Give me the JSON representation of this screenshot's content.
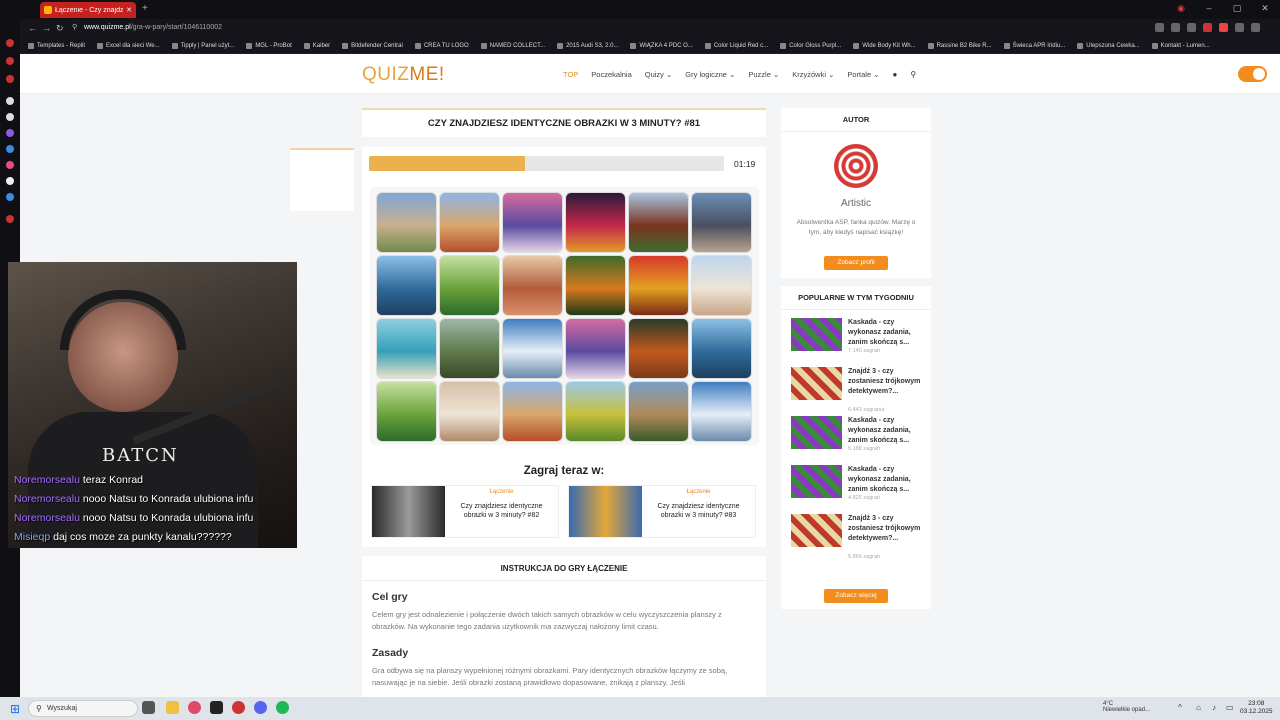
{
  "browser": {
    "tab_title": "Łączenie - Czy znajdziesz",
    "url_host": "www.quizme.pl",
    "url_path": "/gra-w-pary/start/1046110002",
    "bookmarks": [
      "Templates - Replit",
      "Excel dla sieci We...",
      "Tipply | Panel użyt...",
      "MGL - ProBot",
      "Kaiber",
      "Bitdefender Central",
      "CREA TU LOGO",
      "NAMED COLLECT...",
      "2015 Audi S3, 2.0...",
      "WIĄZKA 4 PDC O...",
      "Color Liquid Red c...",
      "Color Gloss Purpl...",
      "Wide Body Kit Wh...",
      "Rassine B2 Bike R...",
      "Świeca APR Iridiu...",
      "Ulepszona Cewka...",
      "Kontakt - Lumen..."
    ]
  },
  "site": {
    "logo_a": "QUIZ",
    "logo_b": "ME!",
    "nav": [
      "TOP",
      "Poczekalnia",
      "Quizy ⌄",
      "Gry logiczne ⌄",
      "Puzzle ⌄",
      "Krzyżówki ⌄",
      "Portale ⌄"
    ]
  },
  "game": {
    "title": "CZY ZNAJDZIESZ IDENTYCZNE OBRAZKI W 3 MINUTY? #81",
    "progress_fraction": 0.44,
    "timer": "01:19",
    "tiles": [
      {
        "name": "osaka-castle",
        "colors": [
          "#7fa6d6",
          "#c9b08e",
          "#6e8a4a"
        ]
      },
      {
        "name": "thai-temple",
        "colors": [
          "#8fb5e8",
          "#d9a76a",
          "#b54d2a"
        ]
      },
      {
        "name": "neon-street",
        "colors": [
          "#d56ba0",
          "#5a4ba0",
          "#e3d4e8"
        ]
      },
      {
        "name": "night-bus",
        "colors": [
          "#2a1c3a",
          "#c2264a",
          "#e59a2a"
        ]
      },
      {
        "name": "pagoda",
        "colors": [
          "#a9c7e3",
          "#7a3420",
          "#3f6a30"
        ]
      },
      {
        "name": "shibuya-street",
        "colors": [
          "#6c8fb8",
          "#4a4f5e",
          "#b6a48e"
        ]
      },
      {
        "name": "torii-sea",
        "colors": [
          "#8cc0e6",
          "#2f6b9c",
          "#1e3f5e"
        ]
      },
      {
        "name": "rice-terraces",
        "colors": [
          "#c5e0a0",
          "#6aa33c",
          "#2d6a2a"
        ]
      },
      {
        "name": "kimono-women",
        "colors": [
          "#e6c9a8",
          "#b35c3a",
          "#d98f6a"
        ]
      },
      {
        "name": "tiger",
        "colors": [
          "#3f6a2a",
          "#d67a1e",
          "#1f3a16"
        ]
      },
      {
        "name": "lanterns",
        "colors": [
          "#d63a2a",
          "#e3a020",
          "#7a2a16"
        ]
      },
      {
        "name": "taj-mahal",
        "colors": [
          "#bfd6ee",
          "#eee4d6",
          "#c9a68a"
        ]
      },
      {
        "name": "beach-boat",
        "colors": [
          "#8dd0e0",
          "#34a0b8",
          "#e8e2c8"
        ]
      },
      {
        "name": "great-wall",
        "colors": [
          "#9cb8a8",
          "#5f7a4a",
          "#3a4a2a"
        ]
      },
      {
        "name": "snow-mountain",
        "colors": [
          "#3f7ec0",
          "#e6eef8",
          "#6a8aa8"
        ]
      },
      {
        "name": "neon-street-2",
        "colors": [
          "#d56ba0",
          "#5a4ba0",
          "#e3d4e8"
        ]
      },
      {
        "name": "orangutan",
        "colors": [
          "#2a3a2a",
          "#c25a1e",
          "#7a3a16"
        ]
      },
      {
        "name": "torii-sea-2",
        "colors": [
          "#8cc0e6",
          "#2f6b9c",
          "#1e3f5e"
        ]
      },
      {
        "name": "rice-terraces-2",
        "colors": [
          "#c5e0a0",
          "#6aa33c",
          "#2d6a2a"
        ]
      },
      {
        "name": "taj-mahal-2",
        "colors": [
          "#d8c0a8",
          "#eee4d6",
          "#b08a6a"
        ]
      },
      {
        "name": "thai-temple-2",
        "colors": [
          "#8fb5e8",
          "#d9a76a",
          "#b54d2a"
        ]
      },
      {
        "name": "yellow-fields",
        "colors": [
          "#9cc8e8",
          "#c8c03a",
          "#5a8a2a"
        ]
      },
      {
        "name": "chiang-mai-temple",
        "colors": [
          "#7aa0c8",
          "#b08a5a",
          "#3a5a2a"
        ]
      },
      {
        "name": "snow-mountain-2",
        "colors": [
          "#3f7ec0",
          "#e6eef8",
          "#6a8aa8"
        ]
      }
    ],
    "play_now": "Zagraj teraz w:",
    "related": [
      {
        "category": "Łączenie",
        "title": "Czy znajdziesz identyczne obrazki w 3 minuty? #82",
        "colors": [
          "#2a2a2a",
          "#9a9a9a"
        ]
      },
      {
        "category": "Łączenie",
        "title": "Czy znajdziesz identyczne obrazki w 3 minuty? #83",
        "colors": [
          "#3a6ab0",
          "#e3a83a"
        ]
      }
    ]
  },
  "instructions": {
    "header": "INSTRUKCJA DO GRY ŁĄCZENIE",
    "goal_title": "Cel gry",
    "goal_text": "Celem gry jest odnalezienie i połączenie dwóch takich samych obrazków w celu wyczyszczenia planszy z obrazków. Na wykonanie tego zadania użytkownik ma zazwyczaj nałożony limit czasu.",
    "rules_title": "Zasady",
    "rules_text": "Gra odbywa się na planszy wypełnionej różnymi obrazkami. Pary identycznych obrazków łączymy ze sobą, nasuwając je na siebie. Jeśli obrazki zostaną prawidłowo dopasowane, znikają z planszy. Jeśli"
  },
  "author": {
    "header": "AUTOR",
    "name": "Artistic",
    "bio": "Absolwentka ASP, fanka quizów. Marzę o tym, aby kiedyś napisać książkę!",
    "button": "Zobacz profil"
  },
  "popular": {
    "header": "POPULARNE W TYM TYGODNIU",
    "items": [
      {
        "title": "Kaskada - czy wykonasz zadania, zanim skończą s...",
        "views": "7.140 zagrań",
        "colors": [
          "#3a8a3a",
          "#8a3ac0"
        ]
      },
      {
        "title": "Znajdź 3 - czy zostaniesz trójkowym detektywem?...",
        "views": "6.443 zagrania",
        "colors": [
          "#e8d8a8",
          "#c03a2a"
        ]
      },
      {
        "title": "Kaskada - czy wykonasz zadania, zanim skończą s...",
        "views": "5.188 zagrań",
        "colors": [
          "#3a8a3a",
          "#8a3ac0"
        ]
      },
      {
        "title": "Kaskada - czy wykonasz zadania, zanim skończą s...",
        "views": "4.825 zagrań",
        "colors": [
          "#3a8a3a",
          "#8a3ac0"
        ]
      },
      {
        "title": "Znajdź 3 - czy zostaniesz trójkowym detektywem?...",
        "views": "5.866 zagrań",
        "colors": [
          "#e8d8a8",
          "#c03a2a"
        ]
      }
    ],
    "more_button": "Zobacz więcej"
  },
  "stream": {
    "watermark": "BATCN",
    "chat": [
      {
        "user": "Noremorsealu",
        "msg": "teraz Konrad"
      },
      {
        "user": "Noremorsealu",
        "msg": "nooo Natsu to Konrada ulubiona infu"
      },
      {
        "user": "Noremorsealu",
        "msg": "nooo Natsu to Konrada ulubiona infu"
      },
      {
        "user": "Misieqp",
        "msg": "daj cos moze za punkty kanalu??????"
      }
    ]
  },
  "taskbar": {
    "search_placeholder": "Wyszukaj",
    "weather_temp": "4°C",
    "weather_desc": "Niewielkie opad...",
    "weather_badge": "1",
    "time": "23:08",
    "date": "03.12.2025"
  }
}
